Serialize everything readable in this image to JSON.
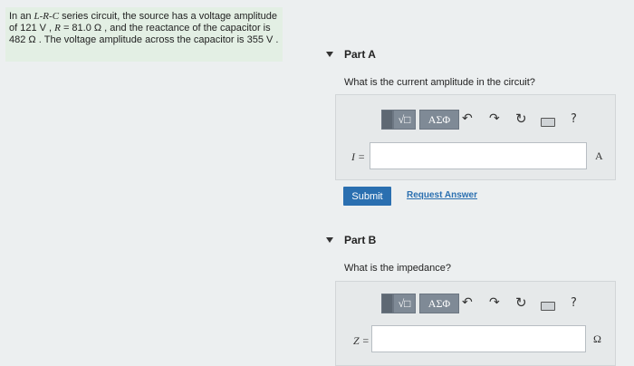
{
  "problem": {
    "line1": "In an ",
    "circuit_type": "L-R-C",
    "line1_rest": " series circuit, the source has a voltage amplitude",
    "line2_pre": "of 121 V , ",
    "r_symbol": "R",
    "line2_mid": " = 81.0 Ω , and the reactance of the capacitor is",
    "line3": "482 Ω . The voltage amplitude across the capacitor is 355 V ."
  },
  "partA": {
    "title": "Part A",
    "question": "What is the current amplitude in the circuit?",
    "var_label": "I =",
    "unit": "A",
    "value": ""
  },
  "partB": {
    "title": "Part B",
    "question": "What is the impedance?",
    "var_label": "Z =",
    "unit": "Ω",
    "value": ""
  },
  "toolbar": {
    "templates_label": "√□",
    "greek_label": "ΑΣΦ",
    "undo_icon": "↶",
    "redo_icon": "↷",
    "reset_icon": "↻",
    "keyboard_icon": "keyboard",
    "help_label": "?"
  },
  "buttons": {
    "submit": "Submit",
    "request_answer": "Request Answer"
  }
}
